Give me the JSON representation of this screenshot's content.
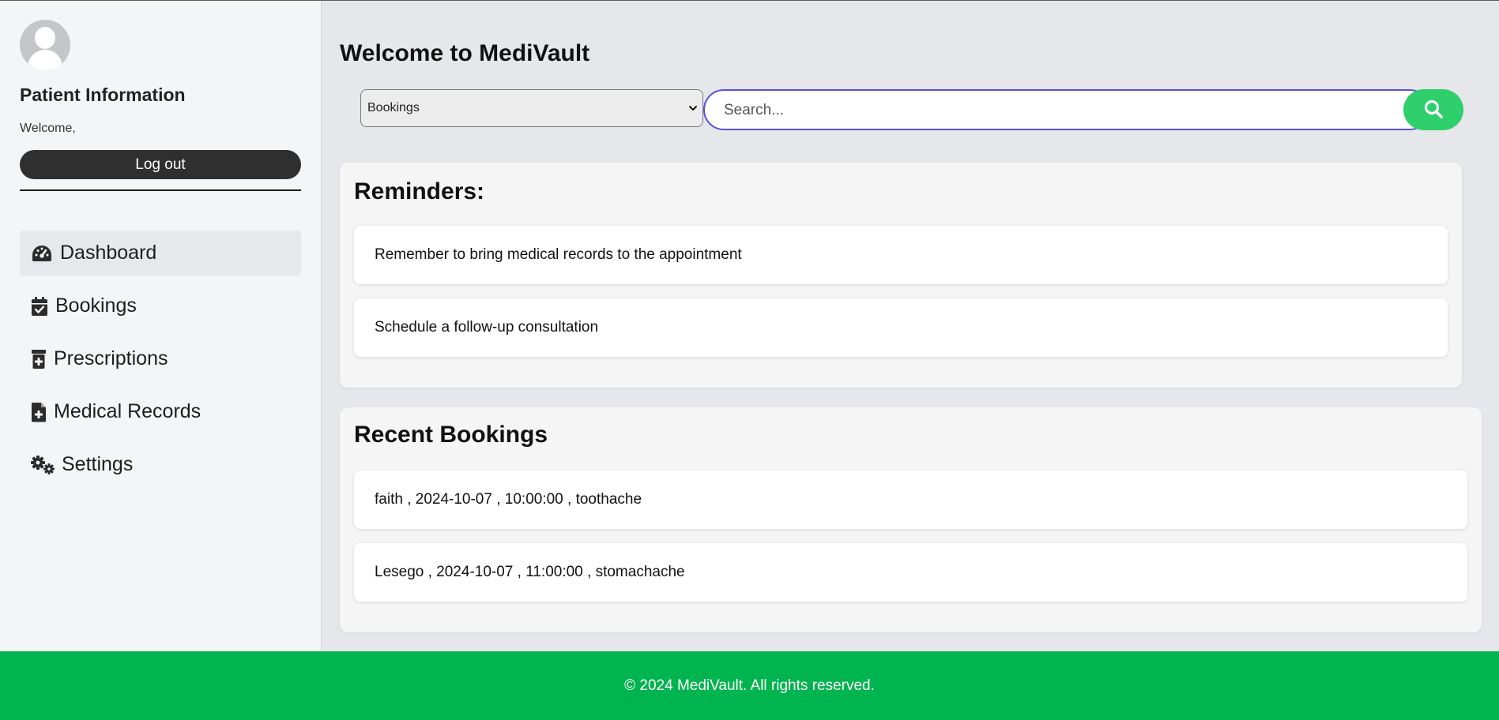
{
  "sidebar": {
    "title": "Patient Information",
    "welcome": "Welcome,",
    "logout_label": "Log out",
    "nav": [
      {
        "label": "Dashboard",
        "icon": "gauge-icon",
        "active": true
      },
      {
        "label": "Bookings",
        "icon": "calendar-check-icon",
        "active": false
      },
      {
        "label": "Prescriptions",
        "icon": "prescription-bottle-icon",
        "active": false
      },
      {
        "label": "Medical Records",
        "icon": "file-medical-icon",
        "active": false
      },
      {
        "label": "Settings",
        "icon": "gears-icon",
        "active": false
      }
    ]
  },
  "header": {
    "title": "Welcome to MediVault"
  },
  "search": {
    "category_selected": "Bookings",
    "placeholder": "Search...",
    "value": ""
  },
  "reminders": {
    "title": "Reminders:",
    "items": [
      "Remember to bring medical records to the appointment",
      "Schedule a follow-up consultation"
    ]
  },
  "recent_bookings": {
    "title": "Recent Bookings",
    "items": [
      "faith , 2024-10-07 , 10:00:00 , toothache",
      "Lesego , 2024-10-07 , 11:00:00 , stomachache"
    ]
  },
  "footer": {
    "text": "© 2024 MediVault. All rights reserved."
  },
  "colors": {
    "footer_bg": "#00b44f",
    "search_button": "#2fcf6c",
    "search_border": "#5a4fe0",
    "logout_bg": "#2f2f2f"
  }
}
